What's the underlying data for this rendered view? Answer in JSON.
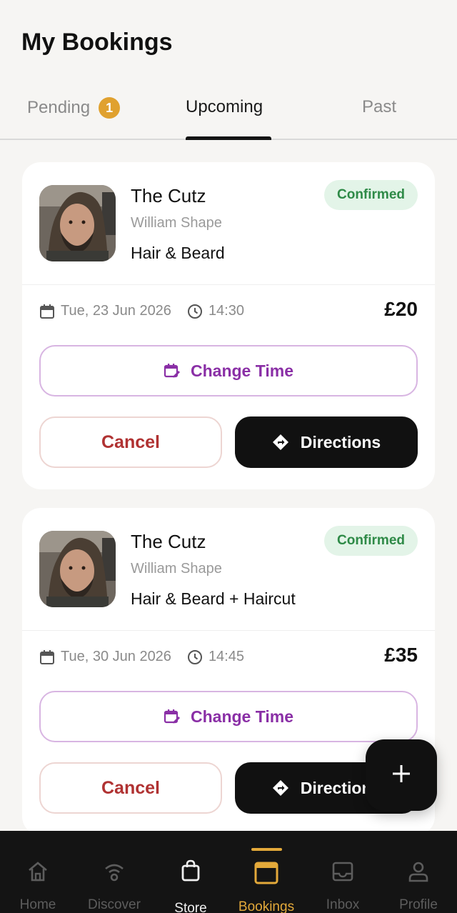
{
  "header": {
    "title": "My Bookings"
  },
  "tabs": [
    {
      "label": "Pending",
      "badge": "1"
    },
    {
      "label": "Upcoming"
    },
    {
      "label": "Past"
    }
  ],
  "bookings": [
    {
      "shop": "The Cutz",
      "barber": "William Shape",
      "service": "Hair & Beard",
      "status": "Confirmed",
      "date": "Tue, 23 Jun 2026",
      "time": "14:30",
      "price": "£20",
      "change_label": "Change Time",
      "cancel_label": "Cancel",
      "directions_label": "Directions"
    },
    {
      "shop": "The Cutz",
      "barber": "William Shape",
      "service": "Hair & Beard + Haircut",
      "status": "Confirmed",
      "date": "Tue, 30 Jun 2026",
      "time": "14:45",
      "price": "£35",
      "change_label": "Change Time",
      "cancel_label": "Cancel",
      "directions_label": "Directions"
    }
  ],
  "fab": {
    "icon": "plus-icon"
  },
  "nav": [
    {
      "label": "Home",
      "icon": "home-icon"
    },
    {
      "label": "Discover",
      "icon": "discover-icon"
    },
    {
      "label": "Store",
      "icon": "shopping-bag-icon"
    },
    {
      "label": "Bookings",
      "icon": "calendar-icon",
      "active": true
    },
    {
      "label": "Inbox",
      "icon": "inbox-icon"
    },
    {
      "label": "Profile",
      "icon": "profile-icon"
    }
  ],
  "colors": {
    "accent": "#e3a93a",
    "purple": "#8a2fa6",
    "confirmed_bg": "#e3f4e8",
    "confirmed_text": "#2e8a47",
    "cancel_text": "#b03232"
  }
}
